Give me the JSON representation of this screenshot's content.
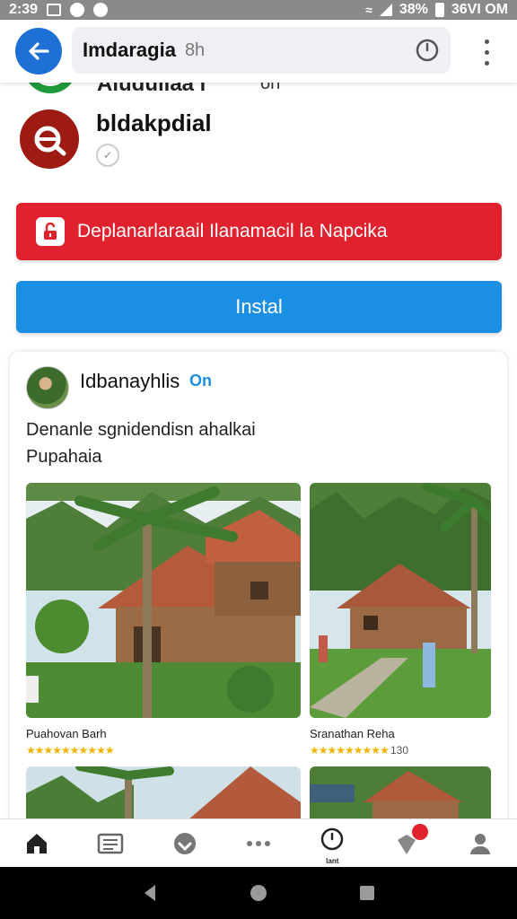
{
  "status_bar": {
    "time": "2:39",
    "battery": "38%",
    "carrier": "36VI OM"
  },
  "search": {
    "query": "Imdaragia",
    "age": "8h"
  },
  "peek_row": {
    "title": "Aluduilaa l",
    "age": "oh"
  },
  "app": {
    "title": "bldakpdial"
  },
  "banner": {
    "text": "Deplanarlaraail Ilanamacil la Napcika"
  },
  "install": {
    "label": "Instal"
  },
  "post": {
    "author": "Idbanayhlis",
    "badge": "On",
    "text_line1": "Denanle sgnidendisn ahalkai",
    "text_line2": "Pupahaia",
    "captions": [
      {
        "title": "Puahovan Barh",
        "stars": "★★★★★★★★★★",
        "count": ""
      },
      {
        "title": "Sranathan Reha",
        "stars": "★★★★★★★★★",
        "count": "130"
      }
    ]
  },
  "bottom_nav": {
    "items": [
      "home-icon",
      "news-icon",
      "download-icon",
      "more-horizontal-icon",
      "clock-icon",
      "notification-icon",
      "profile-icon"
    ],
    "clock_label": "lant"
  },
  "colors": {
    "primary": "#1a8fe3",
    "back": "#1e6fd6",
    "danger": "#e0212e",
    "app_icon": "#9e1b14"
  }
}
